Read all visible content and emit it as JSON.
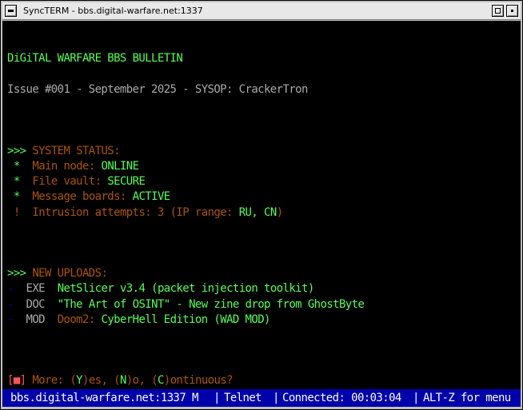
{
  "window": {
    "title": "SyncTERM - bbs.digital-warfare.net:1337"
  },
  "bulletin": {
    "header": "DiGiTAL WARFARE BBS BULLETIN",
    "issue_line": "Issue #001 - September 2025 - SYSOP: CrackerTron"
  },
  "system_status": {
    "prompt": ">>>",
    "heading": "SYSTEM STATUS:",
    "items": [
      {
        "bullet": "*",
        "label": "Main node: ",
        "value": "ONLINE"
      },
      {
        "bullet": "*",
        "label": "File vault: ",
        "value": "SECURE"
      },
      {
        "bullet": "*",
        "label": "Message boards: ",
        "value": "ACTIVE"
      },
      {
        "bullet": "!",
        "label": "Intrusion attempts: 3 (IP range: ",
        "value": "RU, CN",
        "suffix": ")"
      }
    ]
  },
  "uploads": {
    "prompt": ">>>",
    "heading": "NEW UPLOADS:",
    "items": [
      {
        "dash": "-",
        "type": "EXE",
        "title_a": "NetSlicer v3.4 (packet injection toolkit)",
        "title_b": ""
      },
      {
        "dash": "-",
        "type": "DOC",
        "title_a": "\"The Art of OSINT\" - New zine drop from GhostByte",
        "title_b": ""
      },
      {
        "dash": "-",
        "type": "MOD",
        "title_a": "Doom2: ",
        "title_b": "CyberHell Edition (WAD MOD)"
      }
    ]
  },
  "more_prompt": {
    "box": "[■]",
    "text_more": " More: ",
    "y_paren_open": "(",
    "y_key": "Y",
    "y_rest": ")es, ",
    "n_paren_open": "(",
    "n_key": "N",
    "n_rest": ")o, ",
    "c_paren_open": "(",
    "c_key": "C",
    "c_rest": ")ontinuous?"
  },
  "statusbar": {
    "host": "bbs.digital-warfare.net:1337 M",
    "sep": "|",
    "protocol": "Telnet",
    "connected": "Connected: 00:03:04",
    "help": "ALT-Z for menu"
  },
  "colors": {
    "terminal_bg": "#000000",
    "green": "#55ff55",
    "orange": "#aa5500",
    "gray": "#aaaaaa",
    "red": "#ff5555",
    "status_bg": "#0000aa"
  },
  "icons": [
    "close-icon",
    "minimize-icon",
    "maximize-icon"
  ]
}
